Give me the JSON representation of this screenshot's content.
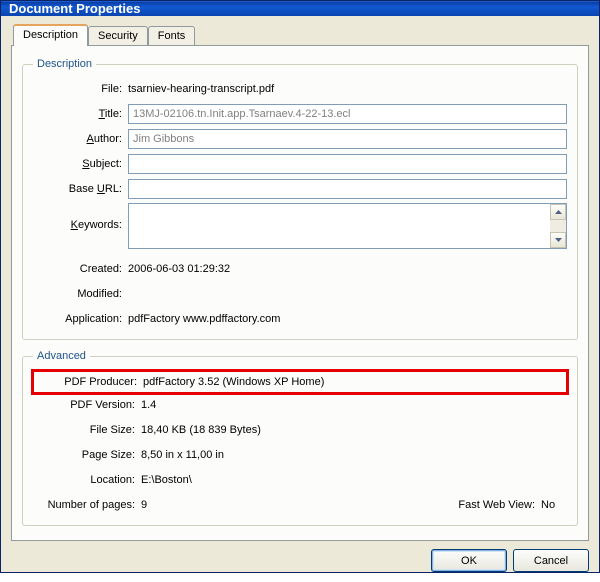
{
  "window": {
    "title": "Document Properties"
  },
  "tabs": [
    {
      "label": "Description",
      "active": true
    },
    {
      "label": "Security",
      "active": false
    },
    {
      "label": "Fonts",
      "active": false
    }
  ],
  "group_titles": {
    "description": "Description",
    "advanced": "Advanced"
  },
  "description": {
    "labels": {
      "file": "File:",
      "title_pre": "",
      "title_u": "T",
      "title_post": "itle:",
      "author_pre": "",
      "author_u": "A",
      "author_post": "uthor:",
      "subject_pre": "",
      "subject_u": "S",
      "subject_post": "ubject:",
      "baseurl_pre": "Base ",
      "baseurl_u": "U",
      "baseurl_post": "RL:",
      "keywords_pre": "",
      "keywords_u": "K",
      "keywords_post": "eywords:",
      "created": "Created:",
      "modified": "Modified:",
      "application": "Application:"
    },
    "file": "tsarniev-hearing-transcript.pdf",
    "title": "13MJ-02106.tn.Init.app.Tsarnaev.4-22-13.ecl",
    "author": "Jim Gibbons",
    "subject": "",
    "base_url": "",
    "keywords": "",
    "created": "2006-06-03 01:29:32",
    "modified": "",
    "application": "pdfFactory www.pdffactory.com"
  },
  "advanced": {
    "labels": {
      "pdf_producer": "PDF Producer:",
      "pdf_version": "PDF Version:",
      "file_size": "File Size:",
      "page_size": "Page Size:",
      "location": "Location:",
      "num_pages": "Number of pages:",
      "fast_web_view": "Fast Web View:"
    },
    "pdf_producer": "pdfFactory 3.52 (Windows XP Home)",
    "pdf_version": "1.4",
    "file_size": "18,40 KB (18 839 Bytes)",
    "page_size": "8,50 in x 11,00 in",
    "location": "E:\\Boston\\",
    "num_pages": "9",
    "fast_web_view": "No"
  },
  "buttons": {
    "ok": "OK",
    "cancel": "Cancel"
  }
}
